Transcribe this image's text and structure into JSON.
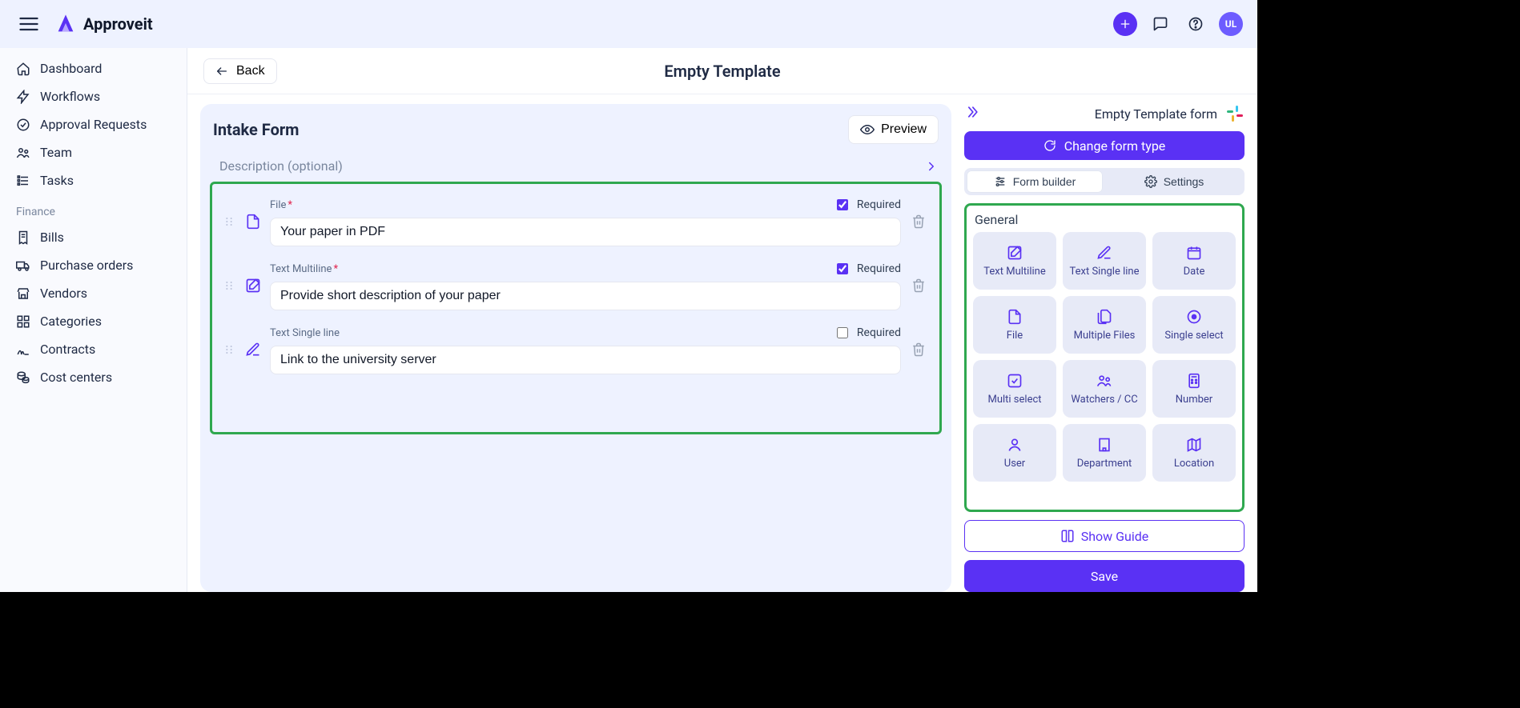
{
  "app": {
    "name": "Approveit",
    "avatar": "UL"
  },
  "sidebar": {
    "items": [
      {
        "label": "Dashboard"
      },
      {
        "label": "Workflows"
      },
      {
        "label": "Approval Requests"
      },
      {
        "label": "Team"
      },
      {
        "label": "Tasks"
      }
    ],
    "finance_label": "Finance",
    "finance": [
      {
        "label": "Bills"
      },
      {
        "label": "Purchase orders"
      },
      {
        "label": "Vendors"
      },
      {
        "label": "Categories"
      },
      {
        "label": "Contracts"
      },
      {
        "label": "Cost centers"
      }
    ]
  },
  "header": {
    "back": "Back",
    "title": "Empty Template"
  },
  "form": {
    "panel_title": "Intake Form",
    "preview": "Preview",
    "description_placeholder": "Description (optional)",
    "required_label": "Required",
    "fields": [
      {
        "type_label": "File",
        "required": true,
        "value": "Your paper in PDF"
      },
      {
        "type_label": "Text Multiline",
        "required": true,
        "value": "Provide short description of your paper"
      },
      {
        "type_label": "Text Single line",
        "required": false,
        "value": "Link to the university server"
      }
    ]
  },
  "right": {
    "title": "Empty Template form",
    "change_type": "Change form type",
    "tabs": {
      "builder": "Form builder",
      "settings": "Settings"
    },
    "palette": {
      "section": "General",
      "items": [
        "Text Multiline",
        "Text Single line",
        "Date",
        "File",
        "Multiple Files",
        "Single select",
        "Multi select",
        "Watchers / CC",
        "Number",
        "User",
        "Department",
        "Location"
      ]
    },
    "guide": "Show Guide",
    "save": "Save"
  }
}
